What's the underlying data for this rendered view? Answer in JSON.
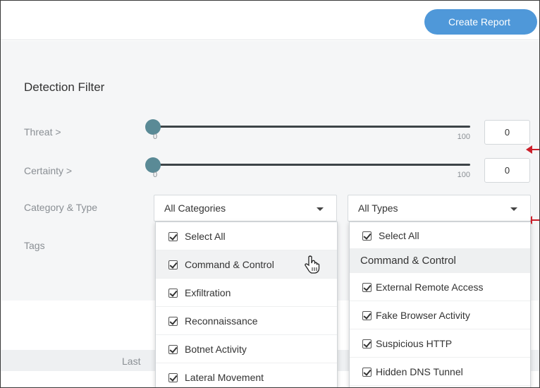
{
  "header": {
    "create_report_label": "Create Report"
  },
  "filter": {
    "title": "Detection Filter",
    "threat": {
      "label": "Threat >",
      "min": "0",
      "max": "100",
      "value": "0"
    },
    "certainty": {
      "label": "Certainty >",
      "min": "0",
      "max": "100",
      "value": "0"
    },
    "category_type_label": "Category & Type",
    "tags_label": "Tags",
    "category_select": "All Categories",
    "type_select": "All Types"
  },
  "categories_menu": [
    {
      "label": "Select All",
      "checked": true
    },
    {
      "label": "Command & Control",
      "checked": true
    },
    {
      "label": "Exfiltration",
      "checked": true
    },
    {
      "label": "Reconnaissance",
      "checked": true
    },
    {
      "label": "Botnet Activity",
      "checked": true
    },
    {
      "label": "Lateral Movement",
      "checked": true
    }
  ],
  "types_menu": {
    "select_all": "Select All",
    "group_header": "Command & Control",
    "items": [
      "External Remote Access",
      "Fake Browser Activity",
      "Suspicious HTTP",
      "Hidden DNS Tunnel"
    ]
  },
  "footer": {
    "last_label": "Last"
  },
  "colors": {
    "accent": "#4f98d9",
    "knob": "#5a8a96",
    "annotation_arrow": "#cc1f2a"
  }
}
